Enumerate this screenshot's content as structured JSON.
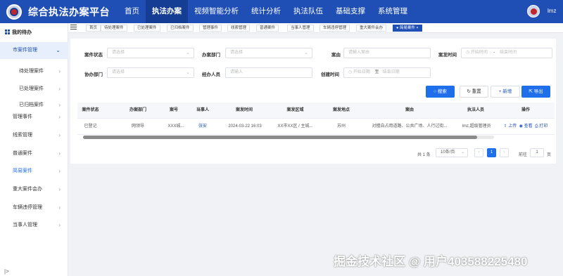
{
  "app": {
    "title": "综合执法办案平台",
    "user": "lmz"
  },
  "topnav": [
    "首页",
    "执法办案",
    "视频智能分析",
    "统计分析",
    "执法队伍",
    "基础支撑",
    "系统管理"
  ],
  "sidebar": {
    "top_item": "我的待办",
    "group_label": "市案件管理",
    "items": [
      "待处理案件",
      "已处理案件",
      "已归档案件",
      "管理事件",
      "线索管理",
      "普通案件",
      "简易案件",
      "重大案件会办",
      "车辆违停管理",
      "当事人管理"
    ],
    "collapse_icon": "|>"
  },
  "tabs": [
    "首页",
    "待处理案件",
    "已处理案件",
    "已归档案件",
    "管理事件",
    "线索管理",
    "普通案件",
    "当事人管理",
    "车辆违停管理",
    "重大案件会办",
    "简易案件"
  ],
  "filters": {
    "status_label": "案件状态",
    "status_placeholder": "请选择",
    "dept_label": "办案部门",
    "dept_placeholder": "请选择",
    "cause_label": "案由",
    "cause_placeholder": "请输入案由",
    "time_label": "案发时间",
    "time_start": "开始时间",
    "time_sep": "-",
    "time_end": "结束时间",
    "assist_label": "协办部门",
    "assist_placeholder": "请选择",
    "staff_label": "经办人员",
    "staff_placeholder": "请输入",
    "created_label": "创建时间",
    "created_start": "开始日期",
    "created_sep": "至",
    "created_end": "结束日期"
  },
  "buttons": {
    "search": "搜索",
    "reset": "重置",
    "add": "新增",
    "export": "导出"
  },
  "table": {
    "headers": [
      "案件状态",
      "办案部门",
      "案号",
      "当事人",
      "案发时间",
      "案发区域",
      "案发地点",
      "案由",
      "执法人员",
      "操作"
    ],
    "rows": [
      [
        "已登记",
        "网领导",
        "XXX城...",
        "张安",
        "2024-03-22 16:03",
        "XX市XX区 / 主城...",
        "苏州",
        "对擅自占用道路、公共广场、人行过街...",
        "lmz,超级管理员",
        ""
      ]
    ],
    "actions": [
      "上传",
      "查看",
      "打印"
    ]
  },
  "pagination": {
    "total": "共 1 条",
    "page_size": "10条/页",
    "current": "1",
    "goto_label": "前往",
    "goto_value": "1",
    "page_unit": "页"
  },
  "watermark": "掘金技术社区 @ 用户403588225480",
  "colors": {
    "brand": "#1f4fb5",
    "primary": "#1f6feb"
  }
}
